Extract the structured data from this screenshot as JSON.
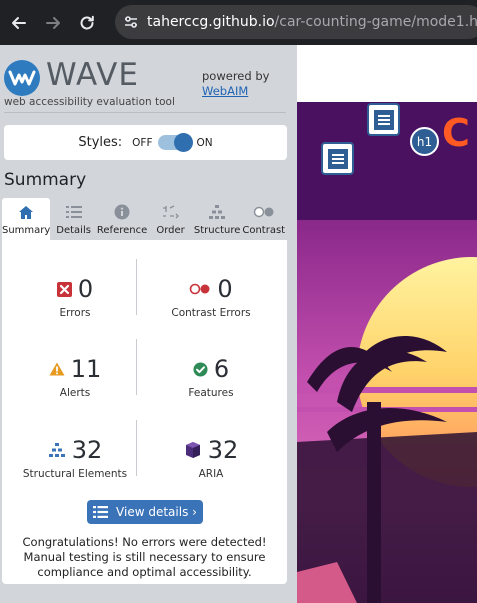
{
  "browser": {
    "url_host": "taherccg.github.io",
    "url_path": "/car-counting-game/mode1.html"
  },
  "wave": {
    "logo_text": "WAVE",
    "logo_subtitle": "web accessibility evaluation tool",
    "powered_by": "powered by",
    "powered_link": "WebAIM",
    "styles": {
      "label": "Styles:",
      "off": "OFF",
      "on": "ON"
    },
    "summary_title": "Summary",
    "tabs": [
      {
        "label": "Summary",
        "icon": "home-icon"
      },
      {
        "label": "Details",
        "icon": "list-icon"
      },
      {
        "label": "Reference",
        "icon": "info-icon"
      },
      {
        "label": "Order",
        "icon": "order-icon"
      },
      {
        "label": "Structure",
        "icon": "structure-icon"
      },
      {
        "label": "Contrast",
        "icon": "contrast-icon"
      }
    ],
    "stats": {
      "errors": {
        "value": "0",
        "label": "Errors"
      },
      "contrast_errors": {
        "value": "0",
        "label": "Contrast Errors"
      },
      "alerts": {
        "value": "11",
        "label": "Alerts"
      },
      "features": {
        "value": "6",
        "label": "Features"
      },
      "structural": {
        "value": "32",
        "label": "Structural Elements"
      },
      "aria": {
        "value": "32",
        "label": "ARIA"
      }
    },
    "view_details": "View details ›",
    "congrats": "Congratulations! No errors were detected! Manual testing is still necessary to ensure compliance and optimal accessibility."
  },
  "page_overlay": {
    "heading_badge": "h1",
    "title_fragment": "C"
  },
  "colors": {
    "accent": "#3b73b9",
    "error": "#c8333a",
    "alert": "#e69a1f",
    "feature": "#2e8b57",
    "aria": "#4b2c7a"
  }
}
